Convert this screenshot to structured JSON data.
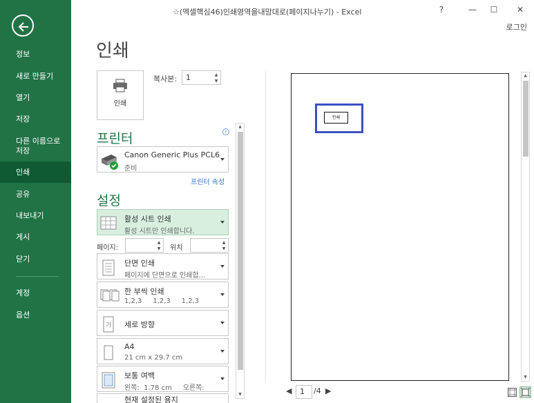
{
  "window": {
    "title": "☆(엑셀핵심46)인쇄영역을내맘대로(페이지나누기) - Excel",
    "help": "?",
    "minimize": "—",
    "maximize": "☐",
    "close": "✕",
    "login": "로그인"
  },
  "nav": {
    "items": [
      "정보",
      "새로 만들기",
      "열기",
      "저장",
      "다른 이름으로 저장",
      "인쇄",
      "공유",
      "내보내기",
      "게시",
      "닫기"
    ],
    "bottom": [
      "계정",
      "옵션"
    ],
    "active": "인쇄"
  },
  "print": {
    "title": "인쇄",
    "button_label": "인쇄",
    "copies_label": "복사본:",
    "copies_value": "1"
  },
  "printer": {
    "heading": "프린터",
    "name": "Canon Generic Plus PCL6",
    "status": "준비",
    "properties_link": "프린터 속성",
    "info": "i"
  },
  "settings": {
    "heading": "설정",
    "what": {
      "title": "활성 시트 인쇄",
      "sub": "활성 시트만 인쇄합니다."
    },
    "pages_label": "페이지:",
    "to_label": "위치",
    "sides": {
      "title": "단면 인쇄",
      "sub": "페이지에 단면으로 인쇄합..."
    },
    "collate": {
      "title": "한 부씩 인쇄",
      "sub": "1,2,3     1,2,3     1,2,3"
    },
    "orientation": {
      "title": "세로 방향"
    },
    "paper": {
      "title": "A4",
      "sub": "21 cm x 29.7 cm"
    },
    "margins": {
      "title": "보통 여백",
      "sub": "왼쪽:  1.78 cm     오른쪽:"
    },
    "scaling": {
      "title": "현재 설정된 용지"
    }
  },
  "preview": {
    "cell_text": "인쇄",
    "page_current": "1",
    "page_total": "/4"
  },
  "colors": {
    "accent": "#217346",
    "selection": "#3b4fc4"
  }
}
